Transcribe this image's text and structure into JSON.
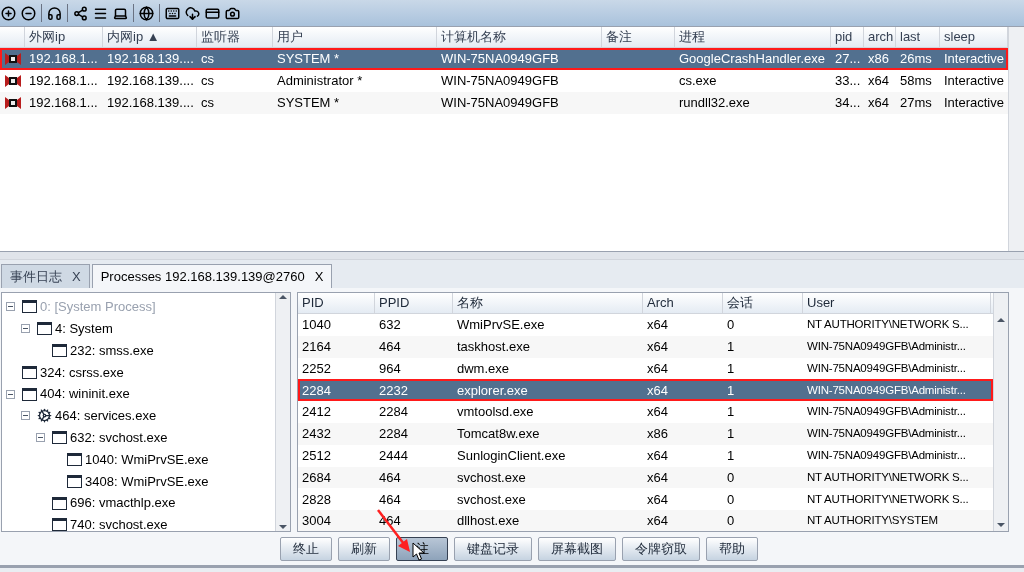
{
  "session_table": {
    "columns": [
      "外网ip",
      "内网ip ▲",
      "监听器",
      "用户",
      "计算机名称",
      "备注",
      "进程",
      "pid",
      "arch",
      "last",
      "sleep"
    ],
    "rows": [
      {
        "selected": true,
        "outlined": true,
        "cells": [
          "192.168.1...",
          "192.168.139....",
          "cs",
          "SYSTEM *",
          "WIN-75NA0949GFB",
          "",
          "GoogleCrashHandler.exe",
          "27...",
          "x86",
          "26ms",
          "Interactive"
        ]
      },
      {
        "selected": false,
        "outlined": false,
        "cells": [
          "192.168.1...",
          "192.168.139....",
          "cs",
          "Administrator *",
          "WIN-75NA0949GFB",
          "",
          "cs.exe",
          "33...",
          "x64",
          "58ms",
          "Interactive"
        ]
      },
      {
        "selected": false,
        "outlined": false,
        "cells": [
          "192.168.1...",
          "192.168.139....",
          "cs",
          "SYSTEM *",
          "WIN-75NA0949GFB",
          "",
          "rundll32.exe",
          "34...",
          "x64",
          "27ms",
          "Interactive"
        ]
      }
    ]
  },
  "tabs": [
    {
      "label": "事件日志",
      "close": "X",
      "selected": false
    },
    {
      "label": "Processes 192.168.139.139@2760",
      "close": "X",
      "selected": true
    }
  ],
  "process_tree": [
    {
      "label": "0: [System Process]",
      "kind": "window",
      "greyed": true,
      "expanded": true,
      "children": [
        {
          "label": "4: System",
          "kind": "window",
          "greyed": false,
          "expanded": true,
          "children": [
            {
              "label": "232: smss.exe",
              "kind": "window",
              "greyed": false
            }
          ]
        }
      ]
    },
    {
      "label": "324: csrss.exe",
      "kind": "window",
      "greyed": false
    },
    {
      "label": "404: wininit.exe",
      "kind": "window",
      "greyed": false,
      "expanded": true,
      "children": [
        {
          "label": "464: services.exe",
          "kind": "service",
          "greyed": false,
          "expanded": true,
          "children": [
            {
              "label": "632: svchost.exe",
              "kind": "window",
              "greyed": false,
              "expanded": true,
              "children": [
                {
                  "label": "1040: WmiPrvSE.exe",
                  "kind": "window",
                  "greyed": false
                },
                {
                  "label": "3408: WmiPrvSE.exe",
                  "kind": "window",
                  "greyed": false
                }
              ]
            },
            {
              "label": "696: vmacthlp.exe",
              "kind": "window",
              "greyed": false
            },
            {
              "label": "740: svchost.exe",
              "kind": "window",
              "greyed": false
            }
          ]
        }
      ]
    }
  ],
  "process_table": {
    "columns": [
      "PID",
      "PPID",
      "名称",
      "Arch",
      "会话",
      "User"
    ],
    "rows": [
      {
        "selected": false,
        "outlined": false,
        "cells": [
          "1040",
          "632",
          "WmiPrvSE.exe",
          "x64",
          "0",
          "NT AUTHORITY\\NETWORK S..."
        ]
      },
      {
        "selected": false,
        "outlined": false,
        "cells": [
          "2164",
          "464",
          "taskhost.exe",
          "x64",
          "1",
          "WIN-75NA0949GFB\\Administr..."
        ]
      },
      {
        "selected": false,
        "outlined": false,
        "cells": [
          "2252",
          "964",
          "dwm.exe",
          "x64",
          "1",
          "WIN-75NA0949GFB\\Administr..."
        ]
      },
      {
        "selected": true,
        "outlined": true,
        "cells": [
          "2284",
          "2232",
          "explorer.exe",
          "x64",
          "1",
          "WIN-75NA0949GFB\\Administr..."
        ]
      },
      {
        "selected": false,
        "outlined": false,
        "cells": [
          "2412",
          "2284",
          "vmtoolsd.exe",
          "x64",
          "1",
          "WIN-75NA0949GFB\\Administr..."
        ]
      },
      {
        "selected": false,
        "outlined": false,
        "cells": [
          "2432",
          "2284",
          "Tomcat8w.exe",
          "x86",
          "1",
          "WIN-75NA0949GFB\\Administr..."
        ]
      },
      {
        "selected": false,
        "outlined": false,
        "cells": [
          "2512",
          "2444",
          "SunloginClient.exe",
          "x64",
          "1",
          "WIN-75NA0949GFB\\Administr..."
        ]
      },
      {
        "selected": false,
        "outlined": false,
        "cells": [
          "2684",
          "464",
          "svchost.exe",
          "x64",
          "0",
          "NT AUTHORITY\\NETWORK S..."
        ]
      },
      {
        "selected": false,
        "outlined": false,
        "cells": [
          "2828",
          "464",
          "svchost.exe",
          "x64",
          "0",
          "NT AUTHORITY\\NETWORK S..."
        ]
      },
      {
        "selected": false,
        "outlined": false,
        "cells": [
          "3004",
          "464",
          "dllhost.exe",
          "x64",
          "0",
          "NT AUTHORITY\\SYSTEM"
        ]
      }
    ]
  },
  "buttons": [
    {
      "label": "终止",
      "pressed": false
    },
    {
      "label": "刷新",
      "pressed": false
    },
    {
      "label": "注",
      "pressed": true
    },
    {
      "label": "键盘记录",
      "pressed": false
    },
    {
      "label": "屏幕截图",
      "pressed": false
    },
    {
      "label": "令牌窃取",
      "pressed": false
    },
    {
      "label": "帮助",
      "pressed": false
    }
  ]
}
